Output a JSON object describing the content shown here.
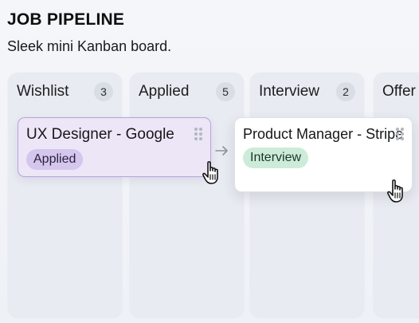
{
  "header": {
    "title": "JOB PIPELINE",
    "subtitle": "Sleek mini Kanban board."
  },
  "columns": [
    {
      "name": "Wishlist",
      "count": "3"
    },
    {
      "name": "Applied",
      "count": "5"
    },
    {
      "name": "Interview",
      "count": "2"
    },
    {
      "name": "Offer",
      "count": ""
    }
  ],
  "cards": [
    {
      "title": "UX Designer - Google",
      "tag": "Applied",
      "tag_color": "#d5c6ee",
      "border_color": "#b7a3df"
    },
    {
      "title": "Product Manager - Stripe",
      "tag": "Interview",
      "tag_color": "#cdebd9"
    }
  ],
  "icons": {
    "drag": "drag-handle-icon",
    "move_arrow": "arrow-right-icon",
    "cursor": "hand-pointer-icon"
  }
}
